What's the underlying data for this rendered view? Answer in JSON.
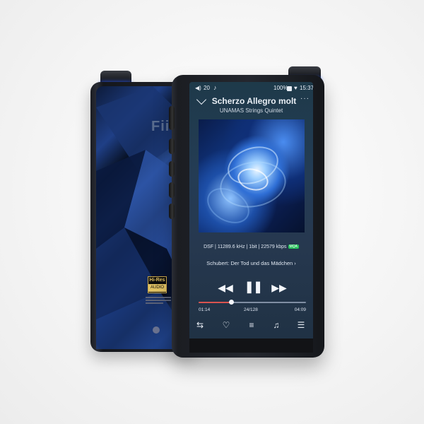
{
  "back_device": {
    "logo": "FiiO",
    "hires_top": "Hi-Res",
    "hires_bottom": "AUDIO"
  },
  "status_bar": {
    "volume_icon": "volume-icon",
    "volume": "20",
    "note_icon": "music-note-icon",
    "battery": "100%",
    "wifi_icon": "wifi-icon",
    "time": "15:37"
  },
  "now_playing": {
    "title": "Scherzo Allegro molt",
    "artist": "UNAMAS Strings Quintet",
    "format": "DSF | 11289.6 kHz | 1bit | 22579 kbps",
    "badge": "MQA",
    "album": "Schubert: Der Tod und das Mädchen  ›",
    "elapsed": "01:14",
    "track_position": "24/128",
    "total": "04:09",
    "progress": 0.3
  },
  "controls": {
    "prev": "◀◀",
    "play_pause": "❚❚",
    "next": "▶▶"
  },
  "bottom_bar": {
    "repeat_icon": "⇆",
    "favorite_icon": "♡",
    "playlist_icon": "≡",
    "eq_icon": "♫",
    "menu_icon": "☰"
  },
  "colors": {
    "accent_ring": "#3565ff",
    "progress": "#d9534f",
    "badge": "#27c25b"
  }
}
